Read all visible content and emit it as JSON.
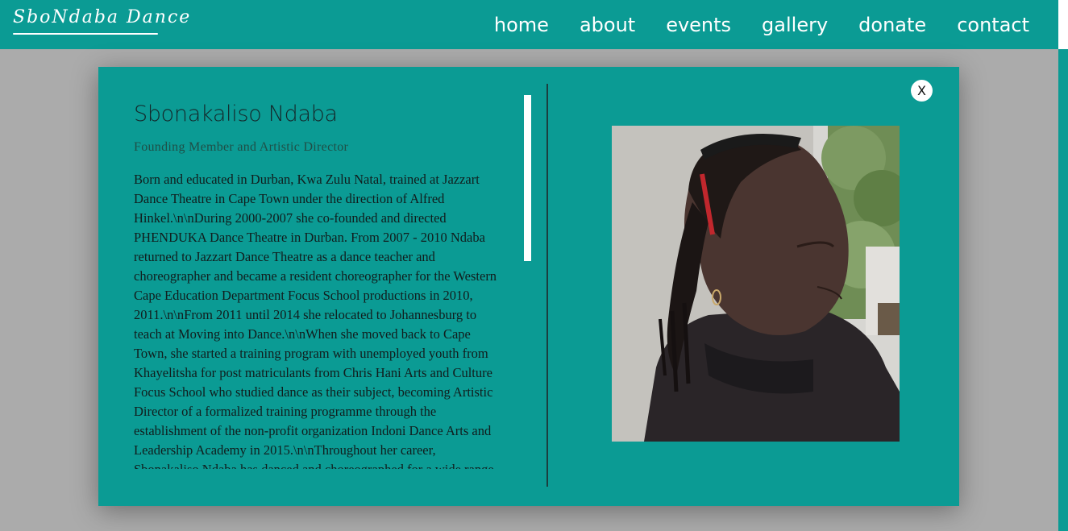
{
  "header": {
    "logo_text": "SboNdaba Dance",
    "nav": [
      "home",
      "about",
      "events",
      "gallery",
      "donate",
      "contact"
    ]
  },
  "modal": {
    "close_label": "X",
    "name": "Sbonakaliso Ndaba",
    "role": "Founding Member and Artistic Director",
    "bio": "Born and educated in Durban, Kwa Zulu Natal, trained at Jazzart Dance Theatre in Cape Town under the direction of Alfred Hinkel.\\n\\nDuring 2000-2007 she co-founded and directed PHENDUKA Dance Theatre in Durban. From 2007 - 2010 Ndaba returned to Jazzart Dance Theatre as a dance teacher and choreographer and became a resident choreographer for the Western Cape Education Department Focus School productions in 2010, 2011.\\n\\nFrom 2011 until 2014 she relocated to Johannesburg to teach at Moving into Dance.\\n\\nWhen she moved back to Cape Town, she started a training program with unemployed youth from Khayelitsha for post matriculants from Chris Hani Arts and Culture Focus School who studied dance as their subject, becoming Artistic Director of a formalized training programme through the establishment of the non-profit organization Indoni Dance Arts and Leadership Academy in 2015.\\n\\nThroughout her career, Sbonakaliso Ndaba has danced and choreographed for a wide range"
  },
  "colors": {
    "brand_teal": "#0b9b94",
    "overlay_gray": "#ababab",
    "white": "#ffffff"
  }
}
